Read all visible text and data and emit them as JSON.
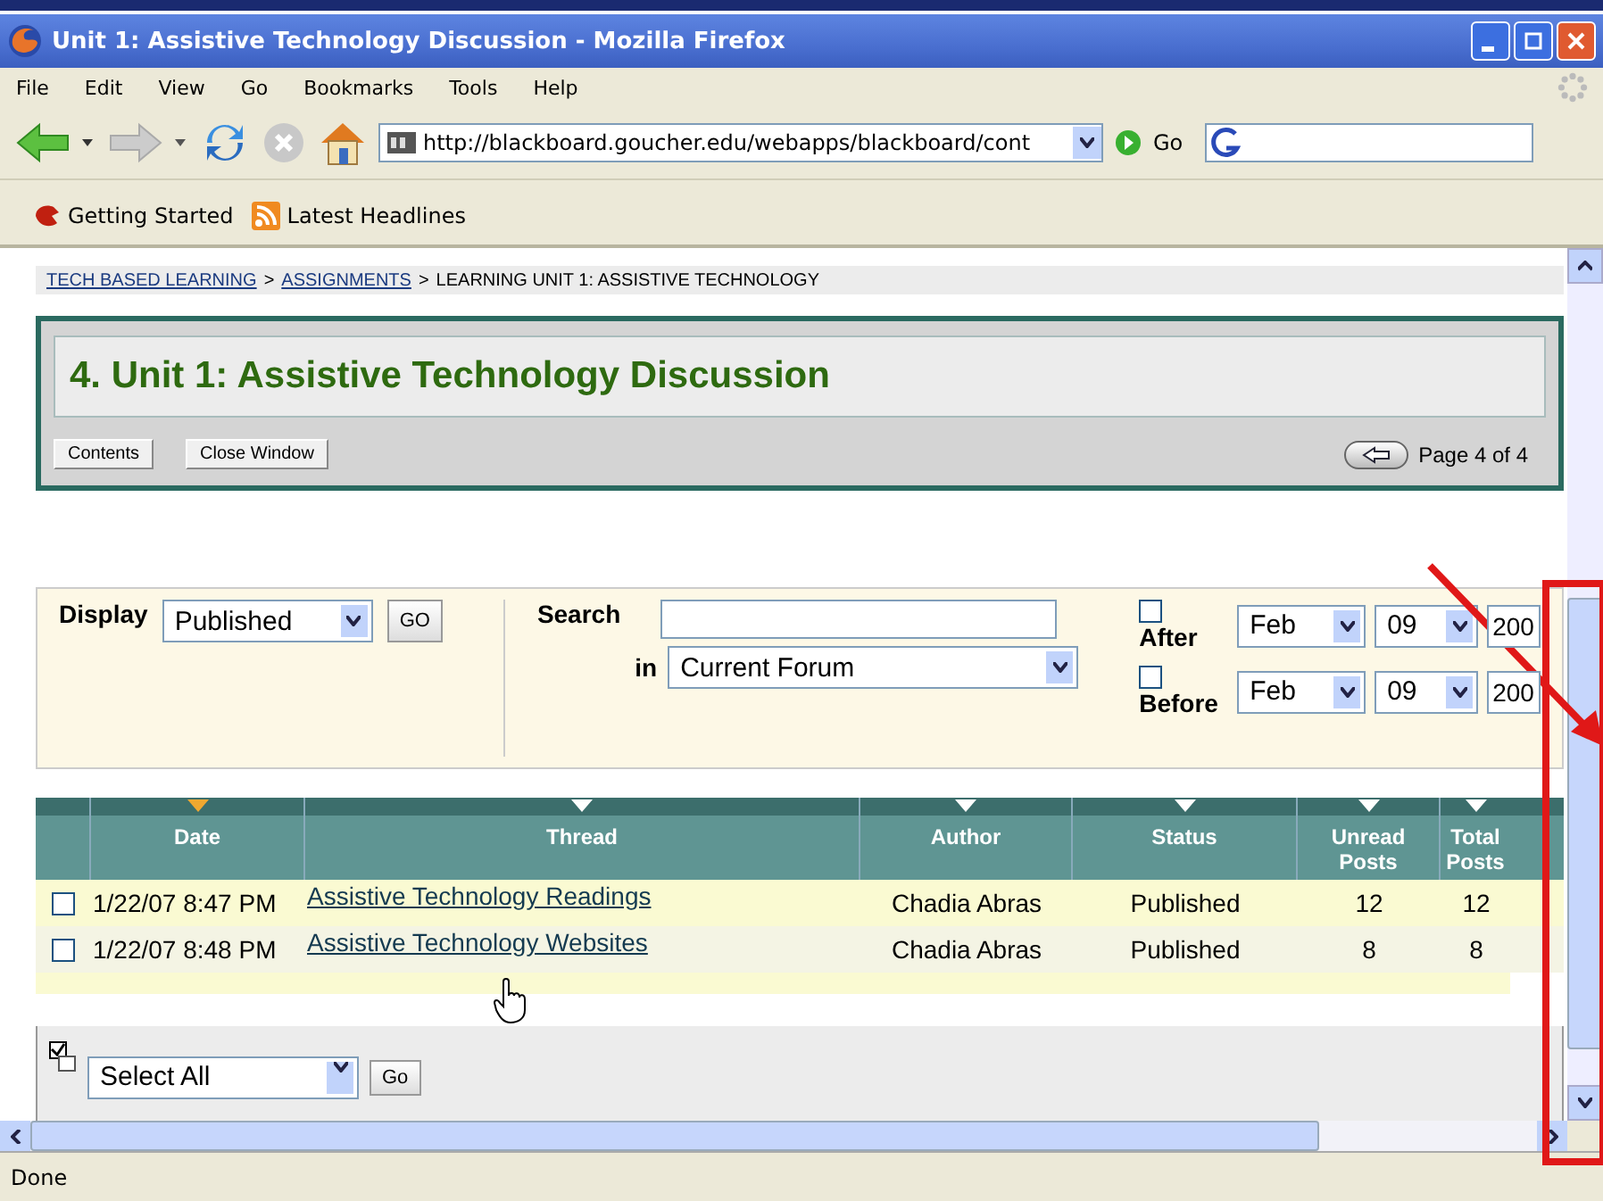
{
  "window": {
    "title": "Unit 1: Assistive Technology Discussion - Mozilla Firefox"
  },
  "menu": [
    "File",
    "Edit",
    "View",
    "Go",
    "Bookmarks",
    "Tools",
    "Help"
  ],
  "navigation": {
    "url": "http://blackboard.goucher.edu/webapps/blackboard/cont",
    "go": "Go"
  },
  "bookmarks": [
    "Getting Started",
    "Latest Headlines"
  ],
  "breadcrumb": [
    {
      "text": "TECH BASED LEARNING",
      "link": true
    },
    {
      "text": ">",
      "link": false
    },
    {
      "text": "ASSIGNMENTS",
      "link": true
    },
    {
      "text": ">",
      "link": false
    },
    {
      "text": "LEARNING UNIT 1: ASSISTIVE TECHNOLOGY",
      "link": false
    }
  ],
  "header": {
    "title": "4. Unit 1: Assistive Technology Discussion",
    "buttons": [
      "Contents",
      "Close Window"
    ],
    "page": "Page 4 of 4"
  },
  "filters": {
    "display_label": "Display",
    "display_value": "Published",
    "display_go": "GO",
    "search_label": "Search",
    "search_in_label": "in",
    "search_in_value": "Current Forum",
    "dates": [
      {
        "label": "After",
        "checked": false,
        "month": "Feb",
        "day": "09",
        "year": "200"
      },
      {
        "label": "Before",
        "checked": false,
        "month": "Feb",
        "day": "09",
        "year": "200"
      }
    ]
  },
  "table": {
    "columns": [
      {
        "label": "Date",
        "sorted": true
      },
      {
        "label": "Thread",
        "sorted": false
      },
      {
        "label": "Author",
        "sorted": false
      },
      {
        "label": "Status",
        "sorted": false
      },
      {
        "label": "Unread Posts",
        "sorted": false
      },
      {
        "label": "Total Posts",
        "sorted": false
      }
    ],
    "rows": [
      {
        "checked": false,
        "date": "1/22/07 8:47 PM",
        "thread": "Assistive Technology Readings",
        "author": "Chadia Abras",
        "status": "Published",
        "unread": "12",
        "total": "12"
      },
      {
        "checked": false,
        "date": "1/22/07 8:48 PM",
        "thread": "Assistive Technology Websites",
        "author": "Chadia Abras",
        "status": "Published",
        "unread": "8",
        "total": "8"
      }
    ]
  },
  "bulk": {
    "select": "Select All",
    "go": "Go"
  },
  "status_bar": "Done"
}
